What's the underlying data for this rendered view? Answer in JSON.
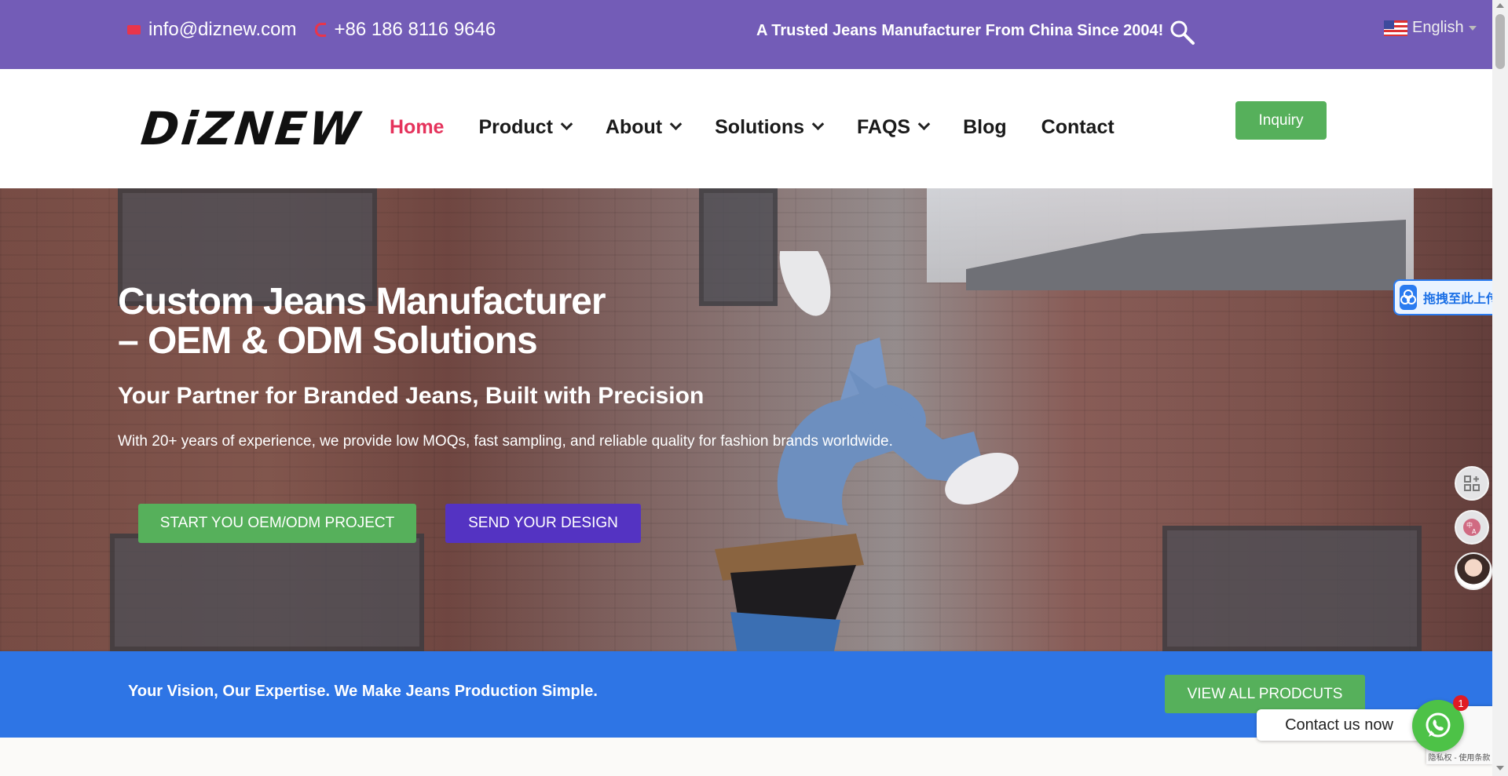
{
  "topbar": {
    "email": "info@diznew.com",
    "phone": "+86 186 8116 9646",
    "tagline": "A Trusted Jeans Manufacturer From China Since 2004!",
    "language": "English"
  },
  "header": {
    "logo": "DiZNEW",
    "nav": [
      {
        "label": "Home",
        "active": true,
        "dropdown": false
      },
      {
        "label": "Product",
        "active": false,
        "dropdown": true
      },
      {
        "label": "About",
        "active": false,
        "dropdown": true
      },
      {
        "label": "Solutions",
        "active": false,
        "dropdown": true
      },
      {
        "label": "FAQS",
        "active": false,
        "dropdown": true
      },
      {
        "label": "Blog",
        "active": false,
        "dropdown": false
      },
      {
        "label": "Contact",
        "active": false,
        "dropdown": false
      }
    ],
    "inquiry_label": "Inquiry"
  },
  "hero": {
    "title_line1": "Custom Jeans Manufacturer",
    "title_line2": "– OEM & ODM Solutions",
    "subtitle": "Your Partner for Branded Jeans, Built with Precision",
    "description": "With 20+ years of experience, we provide low MOQs, fast sampling, and reliable quality for fashion brands worldwide.",
    "primary_button": "START YOU OEM/ODM PROJECT",
    "secondary_button": "SEND YOUR DESIGN"
  },
  "banner": {
    "message": "Your Vision, Our Expertise. We Make Jeans Production Simple.",
    "button": "VIEW ALL PRODCUTS"
  },
  "widgets": {
    "upload_label": "拖拽至此上传",
    "chat_label": "Contact us now",
    "whatsapp_badge": "1",
    "recaptcha_text": "隐私权 - 使用条款"
  },
  "colors": {
    "topbar": "#735cb7",
    "nav_active": "#e5335c",
    "green": "#56b05b",
    "purple_button": "#5433c2",
    "banner": "#2e75e5"
  }
}
